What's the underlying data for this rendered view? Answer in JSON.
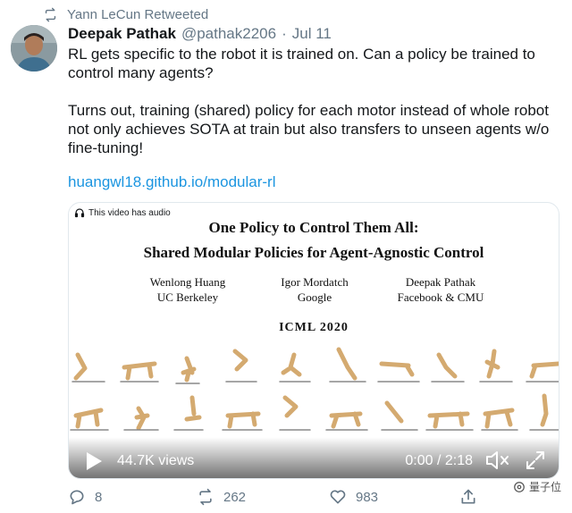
{
  "retweet_header": "Yann LeCun Retweeted",
  "tweet": {
    "display_name": "Deepak Pathak",
    "handle": "@pathak2206",
    "separator": "·",
    "date": "Jul 11",
    "text": "RL gets specific to the robot it is trained on. Can a policy be trained to control many agents?\n\nTurns out, training (shared) policy for each motor instead of whole robot not only achieves SOTA at train but also transfers to unseen agents w/o fine-tuning!",
    "link": "huangwl18.github.io/modular-rl"
  },
  "video": {
    "audio_notice": "This video has audio",
    "slide_title": "One Policy to Control Them All:",
    "slide_subtitle": "Shared Modular Policies for Agent-Agnostic Control",
    "authors": [
      {
        "name": "Wenlong Huang",
        "affiliation": "UC Berkeley"
      },
      {
        "name": "Igor Mordatch",
        "affiliation": "Google"
      },
      {
        "name": "Deepak Pathak",
        "affiliation": "Facebook & CMU"
      }
    ],
    "venue": "ICML 2020",
    "views": "44.7K views",
    "time": "0:00 / 2:18"
  },
  "actions": {
    "replies": "8",
    "retweets": "262",
    "likes": "983"
  },
  "watermark": "量子位",
  "colors": {
    "link": "#1b95e0",
    "secondary_text": "#657786",
    "robot": "#d4aa70"
  },
  "icons": [
    "retweet-icon",
    "play-icon",
    "volume-icon",
    "fullscreen-icon",
    "reply-icon",
    "like-icon",
    "share-icon",
    "headphones-icon"
  ]
}
